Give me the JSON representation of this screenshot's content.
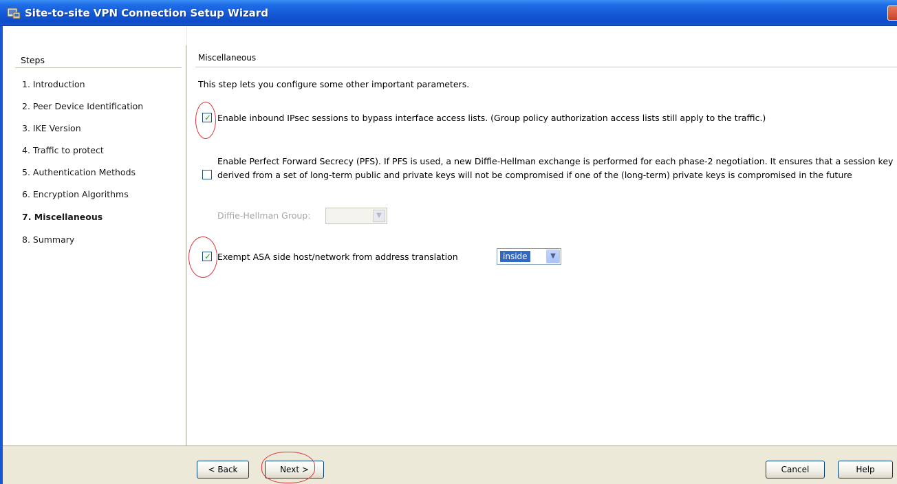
{
  "window": {
    "title": "Site-to-site VPN Connection Setup Wizard"
  },
  "steps": {
    "header": "Steps",
    "items": [
      {
        "label": "1.  Introduction"
      },
      {
        "label": "2.  Peer Device Identification"
      },
      {
        "label": "3.  IKE Version"
      },
      {
        "label": "4.  Traffic to protect"
      },
      {
        "label": "5.  Authentication Methods"
      },
      {
        "label": "6.  Encryption Algorithms"
      },
      {
        "label": "7.  Miscellaneous"
      },
      {
        "label": "8.  Summary"
      }
    ],
    "active_index": 6
  },
  "main": {
    "section_title": "Miscellaneous",
    "intro": "This step lets you configure some other important parameters.",
    "bypass_option": {
      "label": "Enable inbound IPsec sessions to bypass interface access lists. (Group policy authorization access lists still apply to the traffic.)",
      "checked": true
    },
    "pfs_option": {
      "label": "Enable Perfect Forward Secrecy (PFS). If PFS is used, a new Diffie-Hellman exchange is performed for each phase-2 negotiation. It ensures that a session key derived from a set of long-term public and private keys will not be compromised if one of the (long-term) private keys is compromised in the future",
      "checked": false
    },
    "dh_group": {
      "label": "Diffie-Hellman Group:",
      "value": ""
    },
    "exempt_option": {
      "label": "Exempt ASA side host/network from address translation",
      "checked": true,
      "interface_value": "inside"
    }
  },
  "buttons": {
    "back": "< Back",
    "next": "Next >",
    "cancel": "Cancel",
    "help": "Help"
  }
}
